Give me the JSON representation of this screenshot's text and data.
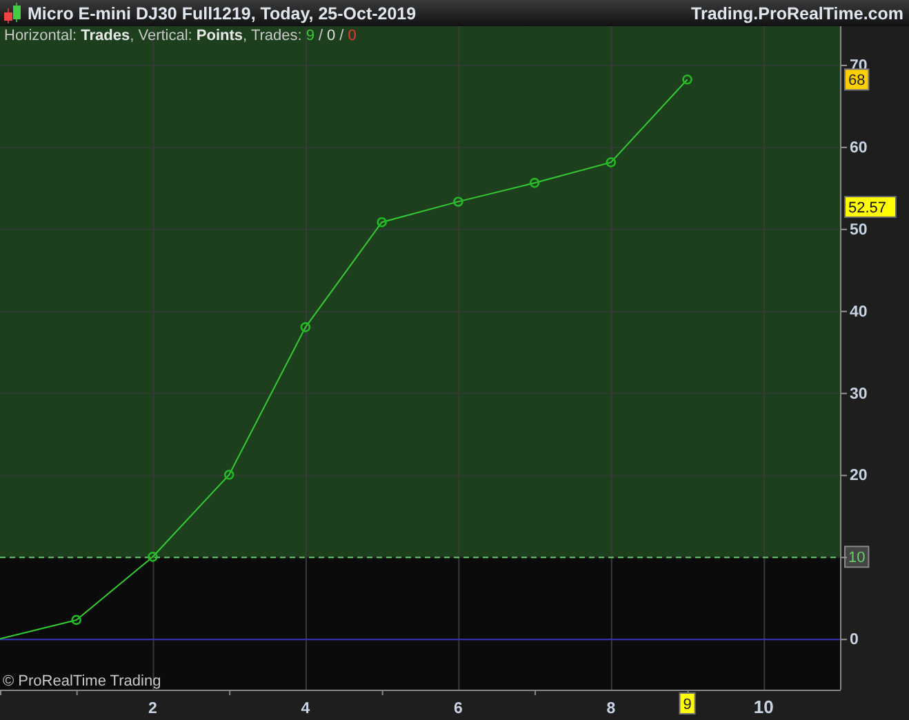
{
  "window": {
    "title": "Micro E-mini DJ30 Full1219, Today, 25-Oct-2019",
    "site": "Trading.ProRealTime.com"
  },
  "legend": {
    "text": "Horizontal: **Trades**, Vertical: **Points**, Trades:",
    "counts": [
      {
        "value": "9",
        "color": "#33cc33"
      },
      {
        "value": "0",
        "color": "#dddddd"
      },
      {
        "value": "0",
        "color": "#ee3333"
      }
    ],
    "separators": [
      "/",
      "/"
    ]
  },
  "chart_data": {
    "type": "line",
    "x": [
      0,
      1,
      2,
      3,
      4,
      5,
      6,
      7,
      8,
      9
    ],
    "series": [
      {
        "color": "#33cc33",
        "marker": "circle",
        "values": [
          0,
          2.3,
          10,
          20,
          38,
          50.8,
          53.3,
          55.6,
          58.1,
          68.2
        ]
      }
    ],
    "xlim": [
      0,
      11
    ],
    "ylim": [
      -6.2,
      74.7
    ],
    "xticks": [
      2,
      4,
      6,
      8,
      10
    ],
    "yticks": [
      0,
      10,
      20,
      30,
      40,
      50,
      60,
      70
    ],
    "grid": true,
    "ref_lines": [
      {
        "axis": "y",
        "value": 0,
        "color": "#3333bb"
      },
      {
        "axis": "y",
        "value": 10,
        "color": "#66cc66",
        "label": "10"
      }
    ],
    "bands": [
      {
        "axis": "y",
        "from": 10,
        "to": 74.7,
        "color": "#1e3f1e"
      }
    ]
  },
  "axis_tags": {
    "last_value": "68",
    "average": "52.57",
    "last_trade": "9"
  },
  "copyright": "© ProRealTime Trading"
}
